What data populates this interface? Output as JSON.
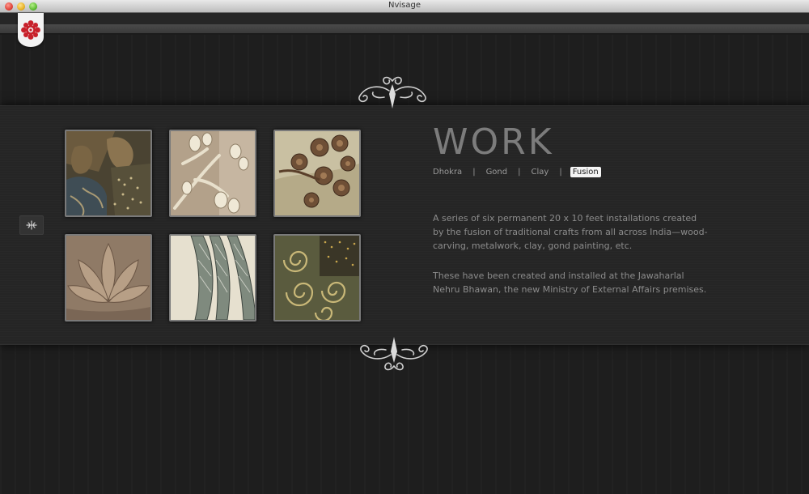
{
  "window": {
    "title": "Nvisage"
  },
  "work": {
    "heading": "WORK",
    "tabs": [
      {
        "label": "Dhokra"
      },
      {
        "label": "Gond"
      },
      {
        "label": "Clay"
      },
      {
        "label": "Fusion"
      }
    ],
    "separator": "|",
    "active_tab": "Fusion",
    "description": [
      "A series of six permanent 20 x 10 feet installations created by the fusion of traditional crafts from all across India—wood-carving, metalwork, clay, gond painting, etc.",
      "These have been created and installed at the Jawaharlal Nehru Bhawan, the new Ministry of External Affairs premises."
    ]
  },
  "icons": {
    "logo": "red-flower-emblem-icon",
    "side_tab": "fleur-icon",
    "ornaments": "filigree-ornament-icon"
  },
  "colors": {
    "logo_red": "#c8202a",
    "active_tab_bg": "#f4f4f4",
    "heading": "#7c7c7c"
  }
}
